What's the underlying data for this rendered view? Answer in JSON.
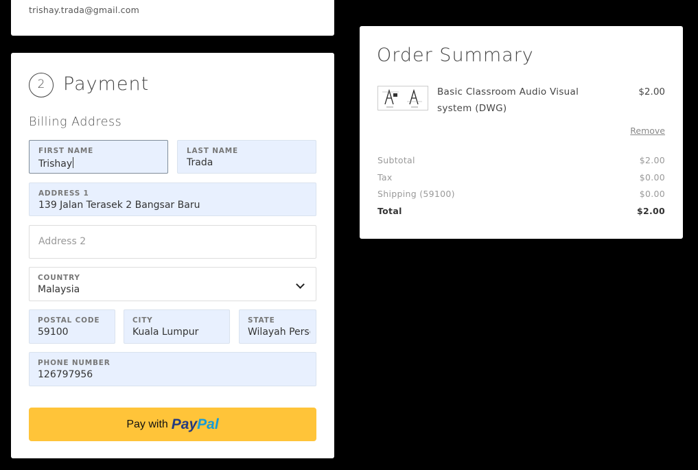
{
  "contact": {
    "email": "trishay.trada@gmail.com"
  },
  "payment": {
    "step_number": "2",
    "title": "Payment",
    "billing_heading": "Billing Address",
    "first_name": {
      "label": "FIRST NAME",
      "value": "Trishay"
    },
    "last_name": {
      "label": "LAST NAME",
      "value": "Trada"
    },
    "address1": {
      "label": "ADDRESS 1",
      "value": "139 Jalan Terasek 2 Bangsar Baru"
    },
    "address2": {
      "placeholder": "Address 2"
    },
    "country": {
      "label": "COUNTRY",
      "value": "Malaysia"
    },
    "postal_code": {
      "label": "POSTAL CODE",
      "value": "59100"
    },
    "city": {
      "label": "CITY",
      "value": "Kuala Lumpur"
    },
    "state": {
      "label": "STATE",
      "value": "Wilayah Persekutuan Kuala Lumpur"
    },
    "phone": {
      "label": "PHONE NUMBER",
      "value": "126797956"
    },
    "paypal_button": {
      "prefix": "Pay with",
      "brand_part1": "Pay",
      "brand_part2": "Pal"
    }
  },
  "summary": {
    "title": "Order Summary",
    "item": {
      "name": "Basic Classroom Audio Visual system (DWG)",
      "price": "$2.00",
      "remove_label": "Remove"
    },
    "rows": [
      {
        "label": "Subtotal",
        "value": "$2.00"
      },
      {
        "label": "Tax",
        "value": "$0.00"
      },
      {
        "label": "Shipping (59100)",
        "value": "$0.00"
      },
      {
        "label": "Total",
        "value": "$2.00"
      }
    ]
  },
  "colors": {
    "accent": "#ffc439",
    "autofill": "#e8f0fe",
    "paypal_dark": "#253b80",
    "paypal_light": "#179bd7"
  }
}
